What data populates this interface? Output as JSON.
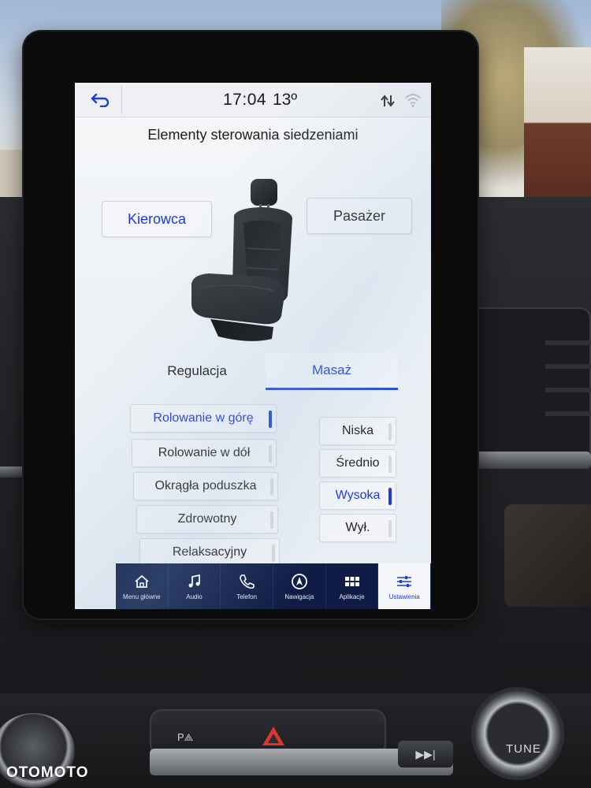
{
  "status_bar": {
    "time": "17:04",
    "temperature": "13º"
  },
  "page_title": "Elementy sterowania siedzeniami",
  "seat_selector": {
    "driver_label": "Kierowca",
    "passenger_label": "Pasażer",
    "selected": "Kierowca"
  },
  "tabs": [
    {
      "label": "Regulacja",
      "active": false
    },
    {
      "label": "Masaż",
      "active": true
    }
  ],
  "massage_programs": [
    {
      "label": "Rolowanie w górę",
      "active": true
    },
    {
      "label": "Rolowanie w dół",
      "active": false
    },
    {
      "label": "Okrągła poduszka",
      "active": false
    },
    {
      "label": "Zdrowotny",
      "active": false
    },
    {
      "label": "Relaksacyjny",
      "active": false
    }
  ],
  "intensity_levels": [
    {
      "label": "Niska",
      "active": false
    },
    {
      "label": "Średnio",
      "active": false
    },
    {
      "label": "Wysoka",
      "active": true
    },
    {
      "label": "Wył.",
      "active": false
    }
  ],
  "nav": [
    {
      "label": "Menu główne",
      "icon": "home-icon",
      "active": false
    },
    {
      "label": "Audio",
      "icon": "music-icon",
      "active": false
    },
    {
      "label": "Telefon",
      "icon": "phone-icon",
      "active": false
    },
    {
      "label": "Nawigacja",
      "icon": "navigation-icon",
      "active": false
    },
    {
      "label": "Aplikacje",
      "icon": "apps-icon",
      "active": false
    },
    {
      "label": "Ustawienia",
      "icon": "settings-sliders-icon",
      "active": true
    }
  ],
  "console": {
    "tune_label": "TUNE"
  },
  "watermark": "OTOMOTO",
  "colors": {
    "accent": "#1e3cd8",
    "nav_bg": "#0e1c46",
    "hazard": "#e0342c"
  }
}
